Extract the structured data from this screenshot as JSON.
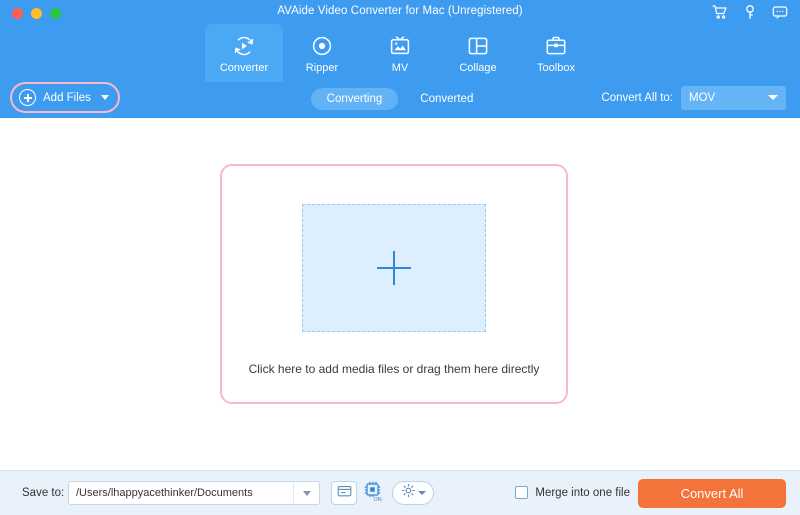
{
  "window": {
    "title": "AVAide Video Converter for Mac (Unregistered)",
    "controls": [
      "close",
      "minimize",
      "maximize"
    ],
    "icons": [
      {
        "name": "cart-icon",
        "label": "Cart"
      },
      {
        "name": "key-icon",
        "label": "Register"
      },
      {
        "name": "feedback-icon",
        "label": "Feedback"
      }
    ]
  },
  "nav": {
    "tabs": [
      {
        "label": "Converter",
        "icon": "converter-icon",
        "active": true
      },
      {
        "label": "Ripper",
        "icon": "ripper-icon",
        "active": false
      },
      {
        "label": "MV",
        "icon": "mv-icon",
        "active": false
      },
      {
        "label": "Collage",
        "icon": "collage-icon",
        "active": false
      },
      {
        "label": "Toolbox",
        "icon": "toolbox-icon",
        "active": false
      }
    ]
  },
  "toolbar": {
    "add_files_label": "Add Files",
    "add_files_icon": "plus-circle-icon",
    "add_files_caret_icon": "chevron-down-icon",
    "segments": [
      {
        "label": "Converting",
        "active": true
      },
      {
        "label": "Converted",
        "active": false
      }
    ],
    "convert_all_to_label": "Convert All to:",
    "convert_all_to_value": "MOV",
    "format_caret_icon": "chevron-down-icon"
  },
  "main": {
    "drop_hint": "Click here to add media files or drag them here directly",
    "plus_icon": "plus-icon"
  },
  "bottom": {
    "save_to_label": "Save to:",
    "save_to_path": "/Users/lhappyacethinker/Documents",
    "path_caret_icon": "chevron-down-icon",
    "folder_icon": "folder-icon",
    "chip_icon": "gpu-acceleration-icon",
    "chip_badge": "ON",
    "gear_icon": "gear-icon",
    "gear_caret_icon": "chevron-down-icon",
    "merge_label": "Merge into one file",
    "merge_checked": false,
    "convert_all_label": "Convert All"
  },
  "colors": {
    "header_blue": "#3d9bf0",
    "active_tab_blue": "#4aa8f5",
    "pink_highlight": "#f9b9cd",
    "dropzone_fill": "#ddeeff",
    "dropzone_border": "#9cc7ea",
    "accent_orange": "#f4733b",
    "bottom_bar": "#e9f2fb"
  }
}
